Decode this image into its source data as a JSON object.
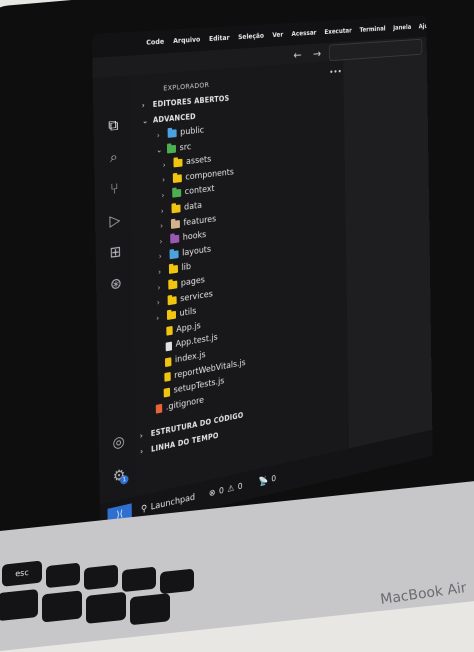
{
  "menu": {
    "items": [
      "Code",
      "Arquivo",
      "Editar",
      "Seleção",
      "Ver",
      "Acessar",
      "Executar",
      "Terminal",
      "Janela",
      "Ajuda"
    ]
  },
  "sidebar": {
    "title": "EXPLORADOR",
    "open_editors": "EDITORES ABERTOS",
    "project": "ADVANCED",
    "tree": [
      {
        "label": "public",
        "type": "folder",
        "color": "#4aa3df",
        "depth": 1
      },
      {
        "label": "src",
        "type": "folder",
        "color": "#4caf50",
        "depth": 1
      },
      {
        "label": "assets",
        "type": "folder",
        "color": "#f1c40f",
        "depth": 2
      },
      {
        "label": "components",
        "type": "folder",
        "color": "#f1c40f",
        "depth": 2
      },
      {
        "label": "context",
        "type": "folder",
        "color": "#4caf50",
        "depth": 2
      },
      {
        "label": "data",
        "type": "folder",
        "color": "#f1c40f",
        "depth": 2
      },
      {
        "label": "features",
        "type": "folder",
        "color": "#d2b48c",
        "depth": 2
      },
      {
        "label": "hooks",
        "type": "folder",
        "color": "#9b59b6",
        "depth": 2
      },
      {
        "label": "layouts",
        "type": "folder",
        "color": "#4aa3df",
        "depth": 2
      },
      {
        "label": "lib",
        "type": "folder",
        "color": "#f1c40f",
        "depth": 2
      },
      {
        "label": "pages",
        "type": "folder",
        "color": "#f1c40f",
        "depth": 2
      },
      {
        "label": "services",
        "type": "folder",
        "color": "#f1c40f",
        "depth": 2
      },
      {
        "label": "utils",
        "type": "folder",
        "color": "#f1c40f",
        "depth": 2
      },
      {
        "label": "App.js",
        "type": "file",
        "color": "#f1c40f",
        "depth": 2
      },
      {
        "label": "App.test.js",
        "type": "file",
        "color": "#e0e0e0",
        "depth": 2
      },
      {
        "label": "index.js",
        "type": "file",
        "color": "#f1c40f",
        "depth": 2
      },
      {
        "label": "reportWebVitals.js",
        "type": "file",
        "color": "#f1c40f",
        "depth": 2
      },
      {
        "label": "setupTests.js",
        "type": "file",
        "color": "#f1c40f",
        "depth": 2
      },
      {
        "label": ".gitignore",
        "type": "file",
        "color": "#e8633a",
        "depth": 1
      }
    ],
    "outline": "ESTRUTURA DO CÓDIGO",
    "timeline": "LINHA DO TEMPO"
  },
  "statusbar": {
    "launchpad": "Launchpad",
    "errors": "0",
    "warnings": "0",
    "ports": "0"
  },
  "badge": "1",
  "keyboard": {
    "esc": "esc",
    "brand": "MacBook Air"
  }
}
